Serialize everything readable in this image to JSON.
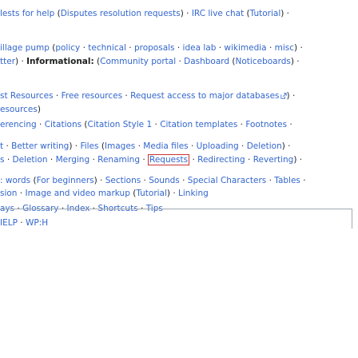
{
  "rows": [
    {
      "id": "r1",
      "parts": [
        {
          "t": "link",
          "v": "lests for help"
        },
        {
          "t": "text",
          "v": " ("
        },
        {
          "t": "link",
          "v": "Disputes resolution requests"
        },
        {
          "t": "text",
          "v": ") · "
        },
        {
          "t": "link",
          "v": "IRC live chat"
        },
        {
          "t": "text",
          "v": " ("
        },
        {
          "t": "link",
          "v": "Tutorial"
        },
        {
          "t": "text",
          "v": ") ·"
        }
      ]
    },
    {
      "id": "r2",
      "parts": [
        {
          "t": "link",
          "v": "illage pump"
        },
        {
          "t": "text",
          "v": " ("
        },
        {
          "t": "link",
          "v": "policy"
        },
        {
          "t": "text",
          "v": " · "
        },
        {
          "t": "link",
          "v": "technical"
        },
        {
          "t": "text",
          "v": " · "
        },
        {
          "t": "link",
          "v": "proposals"
        },
        {
          "t": "text",
          "v": " · "
        },
        {
          "t": "link",
          "v": "idea lab"
        },
        {
          "t": "text",
          "v": " · "
        },
        {
          "t": "link",
          "v": "wikimedia"
        },
        {
          "t": "text",
          "v": " · "
        },
        {
          "t": "link",
          "v": "misc"
        },
        {
          "t": "text",
          "v": ") ·"
        }
      ]
    },
    {
      "id": "r3",
      "parts": [
        {
          "t": "link",
          "v": "tter"
        },
        {
          "t": "text",
          "v": ") · "
        },
        {
          "t": "bold",
          "v": "Informational:"
        },
        {
          "t": "text",
          "v": " ("
        },
        {
          "t": "link",
          "v": "Community portal"
        },
        {
          "t": "text",
          "v": " · "
        },
        {
          "t": "link",
          "v": "Dashboard"
        },
        {
          "t": "text",
          "v": " ("
        },
        {
          "t": "link",
          "v": "Noticeboards"
        },
        {
          "t": "text",
          "v": ") ·"
        }
      ]
    },
    {
      "id": "r4",
      "parts": [
        {
          "t": "link",
          "v": "st Resources"
        },
        {
          "t": "text",
          "v": " · "
        },
        {
          "t": "link",
          "v": "Free resources"
        },
        {
          "t": "text",
          "v": " · "
        },
        {
          "t": "link",
          "v": "Request access to major databases"
        },
        {
          "t": "ext",
          "v": "external-link-icon"
        },
        {
          "t": "text",
          "v": ") ·"
        }
      ]
    },
    {
      "id": "r5",
      "parts": [
        {
          "t": "link",
          "v": "esources"
        },
        {
          "t": "text",
          "v": ")"
        }
      ]
    },
    {
      "id": "r6",
      "parts": [
        {
          "t": "link",
          "v": "erencing"
        },
        {
          "t": "text",
          "v": " · "
        },
        {
          "t": "link",
          "v": "Citations"
        },
        {
          "t": "text",
          "v": " ("
        },
        {
          "t": "link",
          "v": "Citation Style 1"
        },
        {
          "t": "text",
          "v": " · "
        },
        {
          "t": "link",
          "v": "Citation templates"
        },
        {
          "t": "text",
          "v": " · "
        },
        {
          "t": "link",
          "v": "Footnotes"
        },
        {
          "t": "text",
          "v": " ·"
        }
      ]
    },
    {
      "id": "r7",
      "parts": [
        {
          "t": "link",
          "v": "t"
        },
        {
          "t": "text",
          "v": " · "
        },
        {
          "t": "link",
          "v": "Better writing"
        },
        {
          "t": "text",
          "v": ") · "
        },
        {
          "t": "link",
          "v": "Files"
        },
        {
          "t": "text",
          "v": " ("
        },
        {
          "t": "link",
          "v": "Images"
        },
        {
          "t": "text",
          "v": " · "
        },
        {
          "t": "link",
          "v": "Media files"
        },
        {
          "t": "text",
          "v": " · "
        },
        {
          "t": "link",
          "v": "Uploading"
        },
        {
          "t": "text",
          "v": " · "
        },
        {
          "t": "link",
          "v": "Deletion"
        },
        {
          "t": "text",
          "v": ") ·"
        }
      ]
    },
    {
      "id": "r8",
      "parts": [
        {
          "t": "link",
          "v": "s"
        },
        {
          "t": "text",
          "v": " · "
        },
        {
          "t": "link",
          "v": "Deletion"
        },
        {
          "t": "text",
          "v": " · "
        },
        {
          "t": "link",
          "v": "Merging"
        },
        {
          "t": "text",
          "v": " · "
        },
        {
          "t": "link",
          "v": "Renaming"
        },
        {
          "t": "text",
          "v": " · "
        },
        {
          "t": "boxed",
          "v": "Requests"
        },
        {
          "t": "text",
          "v": " · "
        },
        {
          "t": "link",
          "v": "Redirecting"
        },
        {
          "t": "text",
          "v": " · "
        },
        {
          "t": "link",
          "v": "Reverting"
        },
        {
          "t": "text",
          "v": ") ·"
        }
      ]
    },
    {
      "id": "r9",
      "parts": [
        {
          "t": "link",
          "v": ": words"
        },
        {
          "t": "text",
          "v": " ("
        },
        {
          "t": "link",
          "v": "For beginners"
        },
        {
          "t": "text",
          "v": ") · "
        },
        {
          "t": "link",
          "v": "Sections"
        },
        {
          "t": "text",
          "v": " · "
        },
        {
          "t": "link",
          "v": "Sounds"
        },
        {
          "t": "text",
          "v": " · "
        },
        {
          "t": "link",
          "v": "Special Characters"
        },
        {
          "t": "text",
          "v": " · "
        },
        {
          "t": "link",
          "v": "Tables"
        },
        {
          "t": "text",
          "v": " ·"
        }
      ]
    },
    {
      "id": "r10",
      "parts": [
        {
          "t": "link",
          "v": "sion"
        },
        {
          "t": "text",
          "v": " · "
        },
        {
          "t": "link",
          "v": "Image and video markup"
        },
        {
          "t": "text",
          "v": " ("
        },
        {
          "t": "link",
          "v": "Tutorial"
        },
        {
          "t": "text",
          "v": ") · "
        },
        {
          "t": "link",
          "v": "Linking"
        }
      ]
    },
    {
      "id": "r11",
      "parts": [
        {
          "t": "link",
          "v": "ays"
        },
        {
          "t": "text",
          "v": " · "
        },
        {
          "t": "link",
          "v": "Glossary"
        },
        {
          "t": "text",
          "v": " · "
        },
        {
          "t": "link",
          "v": "Index"
        },
        {
          "t": "text",
          "v": " · "
        },
        {
          "t": "link",
          "v": "Shortcuts"
        },
        {
          "t": "text",
          "v": " · "
        },
        {
          "t": "link",
          "v": "Tips"
        }
      ]
    },
    {
      "id": "r12",
      "parts": [
        {
          "t": "link",
          "v": "IELP"
        },
        {
          "t": "text",
          "v": " · "
        },
        {
          "t": "link",
          "v": "WP:H"
        }
      ]
    }
  ]
}
